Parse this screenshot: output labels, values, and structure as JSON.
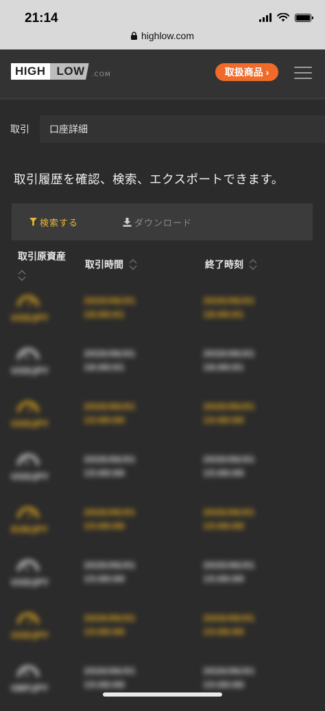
{
  "status": {
    "time": "21:14",
    "url": "highlow.com"
  },
  "header": {
    "logo_high": "HIGH",
    "logo_low": "LOW",
    "logo_com": ".COM",
    "products_label": "取扱商品 ›"
  },
  "tabs": [
    {
      "label": "取引"
    },
    {
      "label": "口座詳細"
    }
  ],
  "intro": "取引履歴を確認、検索、エクスポートできます。",
  "toolbar": {
    "search_label": "検索する",
    "download_label": "ダウンロード"
  },
  "table": {
    "columns": [
      {
        "label": "取引原資産"
      },
      {
        "label": "取引時間"
      },
      {
        "label": "終了時刻"
      }
    ],
    "rows": [
      {
        "status": "gold",
        "pair": "USD/JPY",
        "trade_date": "2020/06/01",
        "trade_time": "18:00:01",
        "end_date": "2020/06/01",
        "end_time": "18:00:01"
      },
      {
        "status": "grey",
        "pair": "USD/JPY",
        "trade_date": "2020/06/01",
        "trade_time": "18:00:01",
        "end_date": "2020/06/01",
        "end_time": "18:00:01"
      },
      {
        "status": "gold",
        "pair": "USD/JPY",
        "trade_date": "2020/06/01",
        "trade_time": "15:00:00",
        "end_date": "2020/06/01",
        "end_time": "15:00:00"
      },
      {
        "status": "grey",
        "pair": "USD/JPY",
        "trade_date": "2020/06/01",
        "trade_time": "15:00:00",
        "end_date": "2020/06/01",
        "end_time": "15:00:00"
      },
      {
        "status": "gold",
        "pair": "EUR/JPY",
        "trade_date": "2020/06/01",
        "trade_time": "15:00:00",
        "end_date": "2020/06/01",
        "end_time": "15:00:00"
      },
      {
        "status": "grey",
        "pair": "USD/JPY",
        "trade_date": "2020/06/01",
        "trade_time": "15:00:00",
        "end_date": "2020/06/01",
        "end_time": "15:00:00"
      },
      {
        "status": "gold",
        "pair": "USD/JPY",
        "trade_date": "2020/06/01",
        "trade_time": "15:00:00",
        "end_date": "2020/06/01",
        "end_time": "15:00:00"
      },
      {
        "status": "grey",
        "pair": "GBP/JPY",
        "trade_date": "2020/06/01",
        "trade_time": "15:00:00",
        "end_date": "2020/06/01",
        "end_time": "15:00:00"
      }
    ]
  },
  "colors": {
    "accent": "#f06a2a",
    "gold": "#e0a51e",
    "background": "#2b2b2b",
    "header": "#333333"
  }
}
